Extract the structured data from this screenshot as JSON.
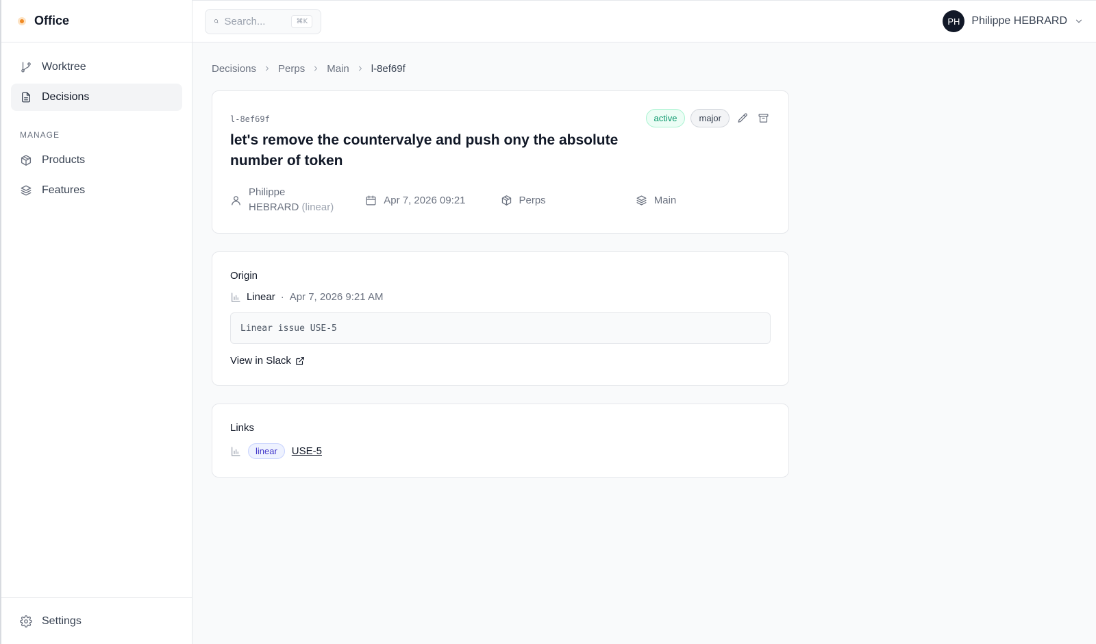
{
  "brand": {
    "name": "Office",
    "accent": "#f08a24"
  },
  "sidebar": {
    "items": [
      {
        "label": "Worktree",
        "icon": "git-branch-icon",
        "active": false
      },
      {
        "label": "Decisions",
        "icon": "document-icon",
        "active": true
      }
    ],
    "section_label": "MANAGE",
    "manage_items": [
      {
        "label": "Products",
        "icon": "package-icon"
      },
      {
        "label": "Features",
        "icon": "layers-icon"
      }
    ],
    "footer": {
      "label": "Settings",
      "icon": "gear-icon"
    }
  },
  "topbar": {
    "search": {
      "placeholder": "Search...",
      "shortcut": "⌘K"
    },
    "user": {
      "initials": "PH",
      "name": "Philippe HEBRARD"
    }
  },
  "breadcrumb": [
    "Decisions",
    "Perps",
    "Main",
    "l-8ef69f"
  ],
  "decision": {
    "id": "l-8ef69f",
    "status": "active",
    "severity": "major",
    "title": "let's remove the countervalye and push ony the absolute number of token",
    "author_first": "Philippe",
    "author_last": "HEBRARD",
    "author_source": "(linear)",
    "date": "Apr 7, 2026 09:21",
    "product": "Perps",
    "feature": "Main"
  },
  "origin": {
    "title": "Origin",
    "source": "Linear",
    "separator": "·",
    "timestamp": "Apr 7, 2026 9:21 AM",
    "content": "Linear issue USE-5",
    "view_link": "View in Slack"
  },
  "links": {
    "title": "Links",
    "items": [
      {
        "type": "linear",
        "ref": "USE-5"
      }
    ]
  }
}
